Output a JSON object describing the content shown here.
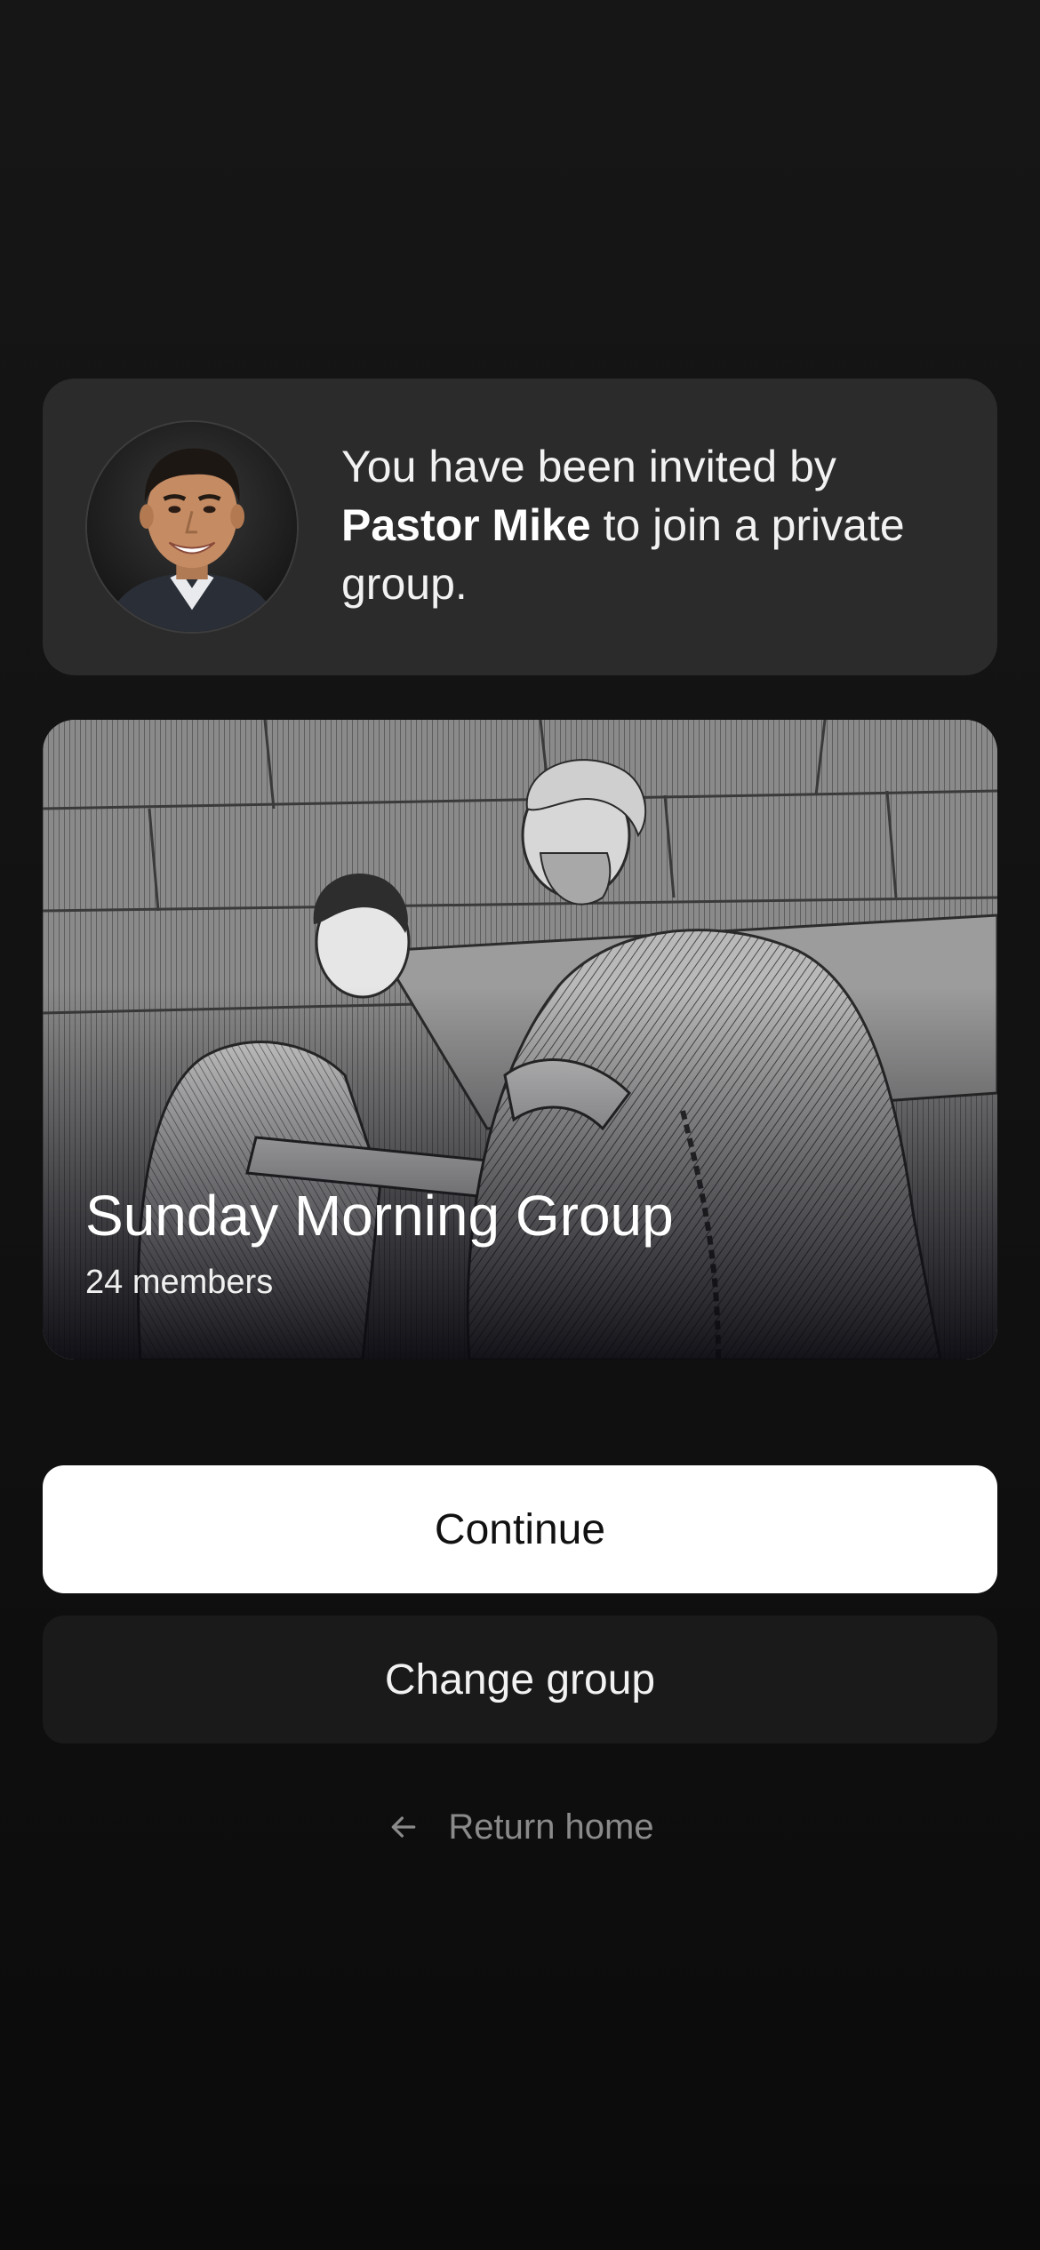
{
  "invite": {
    "prefix": "You have been invited by ",
    "inviter": "Pastor Mike",
    "suffix": " to join a private group."
  },
  "group": {
    "name": "Sunday Morning Group",
    "members": "24 members"
  },
  "actions": {
    "continue_label": "Continue",
    "change_group_label": "Change group",
    "return_home_label": "Return home"
  },
  "icons": {
    "back": "arrow-left-icon",
    "avatar": "avatar",
    "cover": "group-cover-image"
  },
  "colors": {
    "background": "#121212",
    "card": "#2b2b2b",
    "primary_button": "#ffffff",
    "secondary_button": "#1a1a1a",
    "muted_text": "#8a8a8a"
  }
}
